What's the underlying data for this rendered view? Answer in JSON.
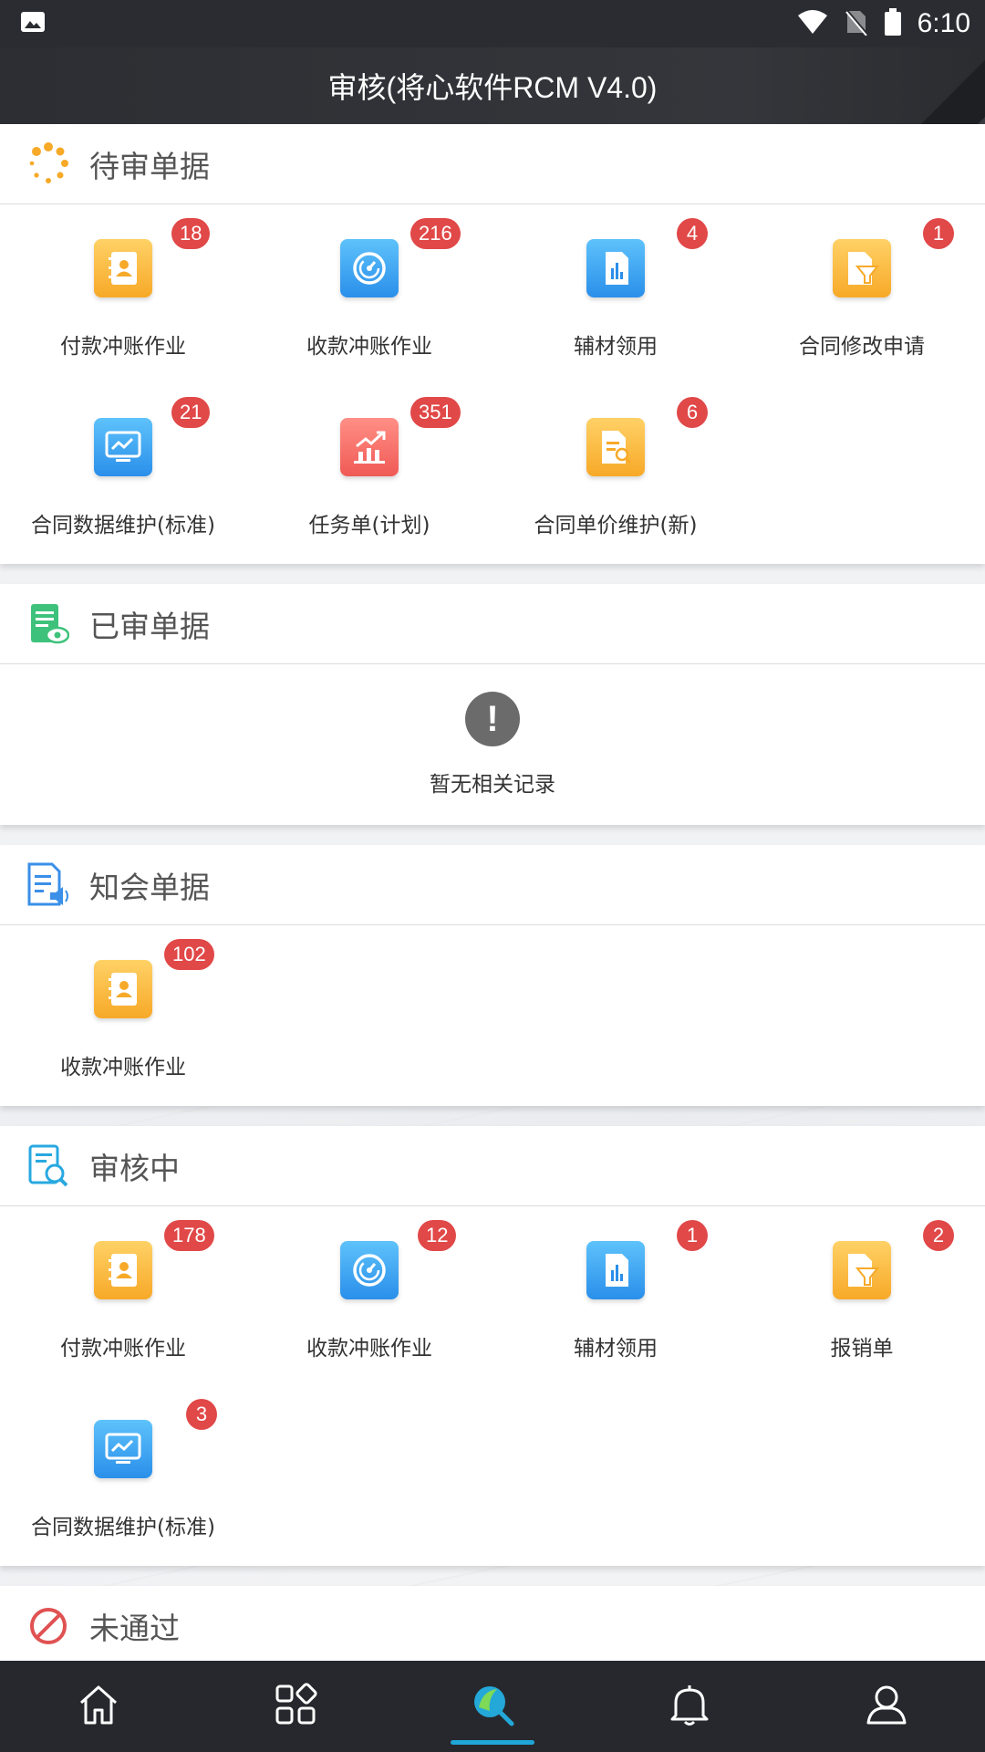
{
  "status_bar": {
    "time": "6:10"
  },
  "header": {
    "title": "审核(将心软件RCM V4.0)"
  },
  "sections": [
    {
      "title": "待审单据",
      "icon": "loading-dots-icon",
      "items": [
        {
          "label": "付款冲账作业",
          "badge": "18",
          "icon": "contacts-book-icon",
          "color": "orange"
        },
        {
          "label": "收款冲账作业",
          "badge": "216",
          "icon": "gauge-icon",
          "color": "blue"
        },
        {
          "label": "辅材领用",
          "badge": "4",
          "icon": "report-chart-icon",
          "color": "blue"
        },
        {
          "label": "合同修改申请",
          "badge": "1",
          "icon": "document-filter-icon",
          "color": "orange"
        },
        {
          "label": "合同数据维护(标准)",
          "badge": "21",
          "icon": "monitor-trend-icon",
          "color": "blue"
        },
        {
          "label": "任务单(计划)",
          "badge": "351",
          "icon": "growth-chart-icon",
          "color": "red"
        },
        {
          "label": "合同单价维护(新)",
          "badge": "6",
          "icon": "document-search-icon",
          "color": "orange"
        }
      ]
    },
    {
      "title": "已审单据",
      "icon": "list-eye-icon",
      "empty_text": "暂无相关记录"
    },
    {
      "title": "知会单据",
      "icon": "document-speaker-icon",
      "items": [
        {
          "label": "收款冲账作业",
          "badge": "102",
          "icon": "contacts-book-icon",
          "color": "orange"
        }
      ]
    },
    {
      "title": "审核中",
      "icon": "list-search-icon",
      "items": [
        {
          "label": "付款冲账作业",
          "badge": "178",
          "icon": "contacts-book-icon",
          "color": "orange"
        },
        {
          "label": "收款冲账作业",
          "badge": "12",
          "icon": "gauge-icon",
          "color": "blue"
        },
        {
          "label": "辅材领用",
          "badge": "1",
          "icon": "report-chart-icon",
          "color": "blue"
        },
        {
          "label": "报销单",
          "badge": "2",
          "icon": "document-filter-icon",
          "color": "orange"
        },
        {
          "label": "合同数据维护(标准)",
          "badge": "3",
          "icon": "monitor-trend-icon",
          "color": "blue"
        }
      ]
    },
    {
      "title": "未通过",
      "icon": "prohibited-icon"
    }
  ],
  "bottom_nav": [
    {
      "icon": "home-icon",
      "active": false
    },
    {
      "icon": "apps-icon",
      "active": false
    },
    {
      "icon": "search-active-icon",
      "active": true
    },
    {
      "icon": "bell-icon",
      "active": false
    },
    {
      "icon": "user-icon",
      "active": false
    }
  ],
  "colors": {
    "header_bg": "#2c2e33",
    "badge": "#e14848",
    "nav_indicator": "#1fa7d8",
    "tile_orange": "#f7a928",
    "tile_blue": "#2a8fea",
    "tile_red": "#f05a55"
  }
}
